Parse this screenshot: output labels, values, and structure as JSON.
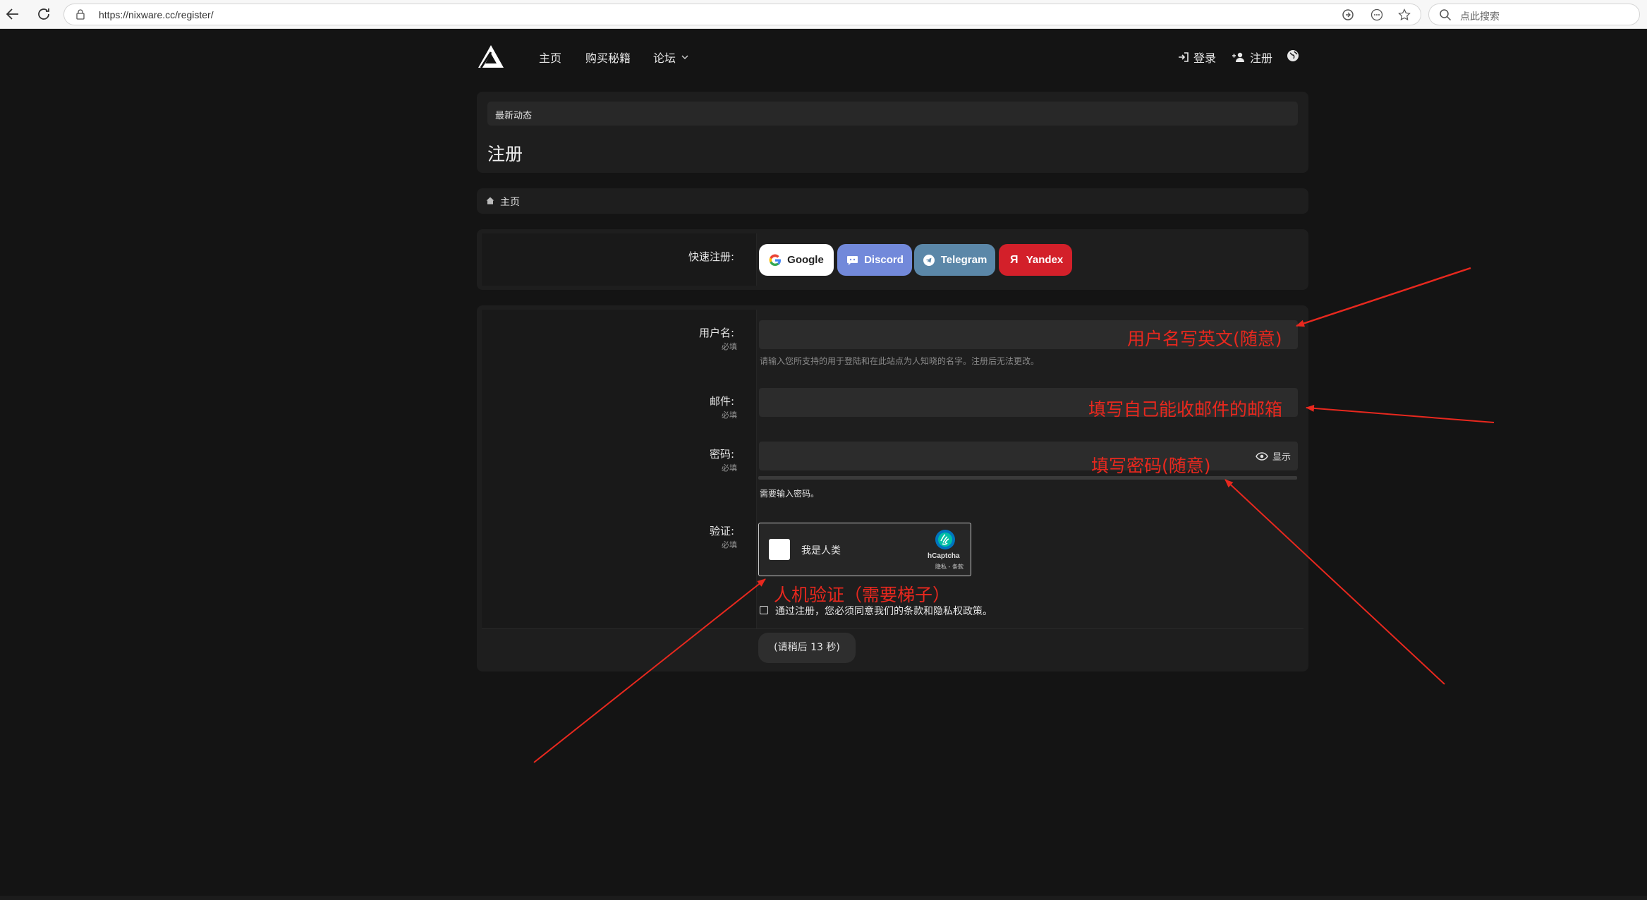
{
  "browser": {
    "url": "https://nixware.cc/register/",
    "search_placeholder": "点此搜索"
  },
  "header": {
    "nav": [
      "主页",
      "购买秘籍",
      "论坛"
    ],
    "login": "登录",
    "register": "注册"
  },
  "title_panel": {
    "recent": "最新动态",
    "title": "注册"
  },
  "breadcrumb": {
    "home": "主页"
  },
  "quick": {
    "label": "快速注册:",
    "buttons": [
      {
        "label": "Google",
        "bg": "#ffffff",
        "fg": "#222222"
      },
      {
        "label": "Discord",
        "bg": "#7289da",
        "fg": "#ffffff"
      },
      {
        "label": "Telegram",
        "bg": "#5b87a8",
        "fg": "#ffffff"
      },
      {
        "label": "Yandex",
        "bg": "#d3202a",
        "fg": "#ffffff"
      }
    ]
  },
  "form": {
    "required": "必填",
    "username_label": "用户名:",
    "username_hint": "请输入您所支持的用于登陆和在此站点为人知晓的名字。注册后无法更改。",
    "email_label": "邮件:",
    "password_label": "密码:",
    "show_label": "显示",
    "password_hint": "需要输入密码。",
    "captcha_label": "验证:",
    "captcha_text": "我是人类",
    "captcha_brand": "hCaptcha",
    "captcha_links": "隐私 - 条款",
    "agree_text": "通过注册，您必须同意我们的条款和隐私权政策。",
    "submit": "(请稍后 13 秒)"
  },
  "annotations": {
    "username": "用户名写英文(随意)",
    "email": "填写自己能收邮件的邮箱",
    "password": "填写密码(随意)",
    "captcha": "人机验证（需要梯子）"
  },
  "colors": {
    "annotation": "#e8281e",
    "background": "#141414",
    "panel": "#1e1e1e"
  }
}
